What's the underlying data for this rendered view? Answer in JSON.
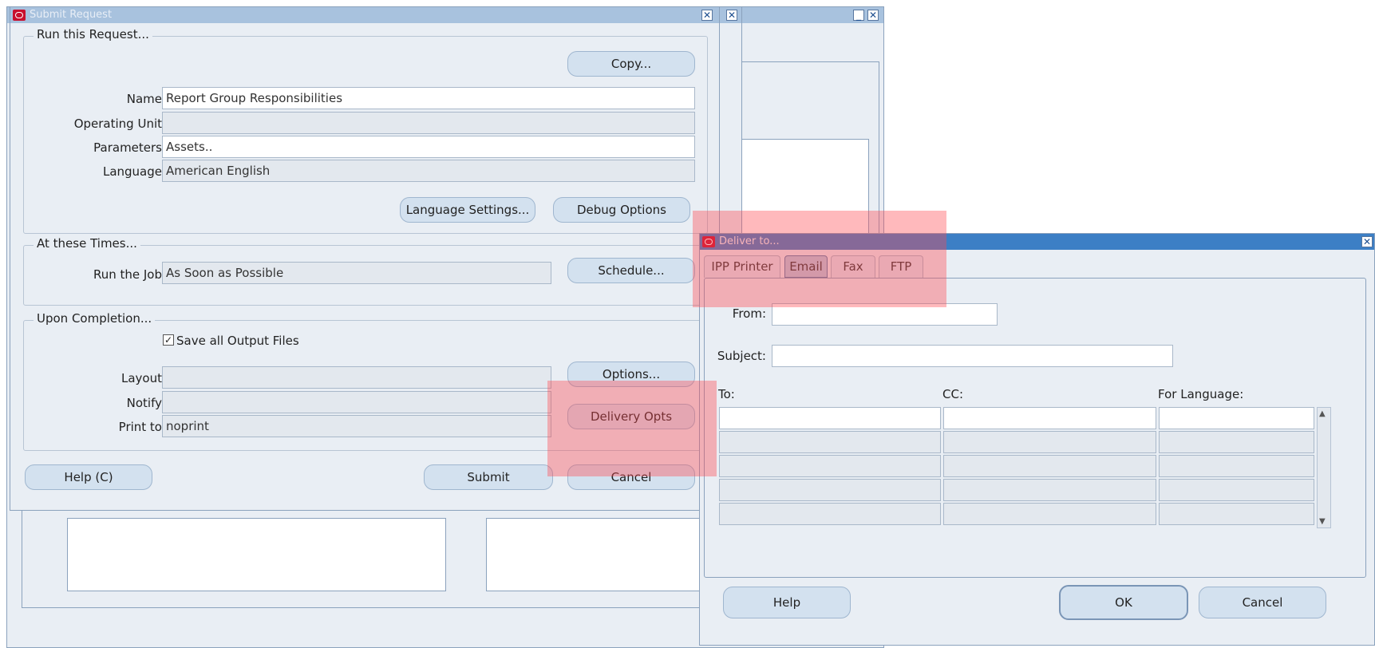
{
  "submit_window": {
    "title": "Submit Request",
    "run_group": {
      "legend": "Run this Request...",
      "copy_label": "Copy...",
      "name_label": "Name",
      "name_value": "Report Group Responsibilities",
      "operating_unit_label": "Operating Unit",
      "operating_unit_value": "",
      "parameters_label": "Parameters",
      "parameters_value": "Assets..",
      "language_label": "Language",
      "language_value": "American English",
      "language_settings_label": "Language Settings...",
      "debug_options_label": "Debug Options"
    },
    "times_group": {
      "legend": "At these Times...",
      "run_job_label": "Run the Job",
      "run_job_value": "As Soon as Possible",
      "schedule_label": "Schedule..."
    },
    "completion_group": {
      "legend": "Upon Completion...",
      "save_output_label": "Save all Output Files",
      "save_output_checked": true,
      "layout_label": "Layout",
      "layout_value": "",
      "notify_label": "Notify",
      "notify_value": "",
      "print_to_label": "Print to",
      "print_to_value": "noprint",
      "options_label": "Options...",
      "delivery_opts_label": "Delivery Opts"
    },
    "help_label": "Help (C)",
    "submit_label": "Submit",
    "cancel_label": "Cancel"
  },
  "deliver_window": {
    "title": "Deliver to...",
    "tabs": [
      {
        "label": "IPP Printer",
        "selected": false
      },
      {
        "label": "Email",
        "selected": true
      },
      {
        "label": "Fax",
        "selected": false
      },
      {
        "label": "FTP",
        "selected": false
      }
    ],
    "from_label": "From:",
    "from_value": "",
    "subject_label": "Subject:",
    "subject_value": "",
    "to_header": "To:",
    "cc_header": "CC:",
    "for_language_header": "For Language:",
    "help_label": "Help",
    "ok_label": "OK",
    "cancel_label": "Cancel"
  },
  "colors": {
    "window_bg": "#e9eef4",
    "inactive_title": "#a8c2de",
    "active_title": "#3c7fc5",
    "button_bg": "#d3e1ef",
    "highlight_overlay": "#ff4650"
  },
  "icons": [
    "oracle-logo-icon",
    "close-icon",
    "minimize-icon",
    "checkbox-check-icon",
    "scroll-up-icon",
    "scroll-down-icon"
  ]
}
